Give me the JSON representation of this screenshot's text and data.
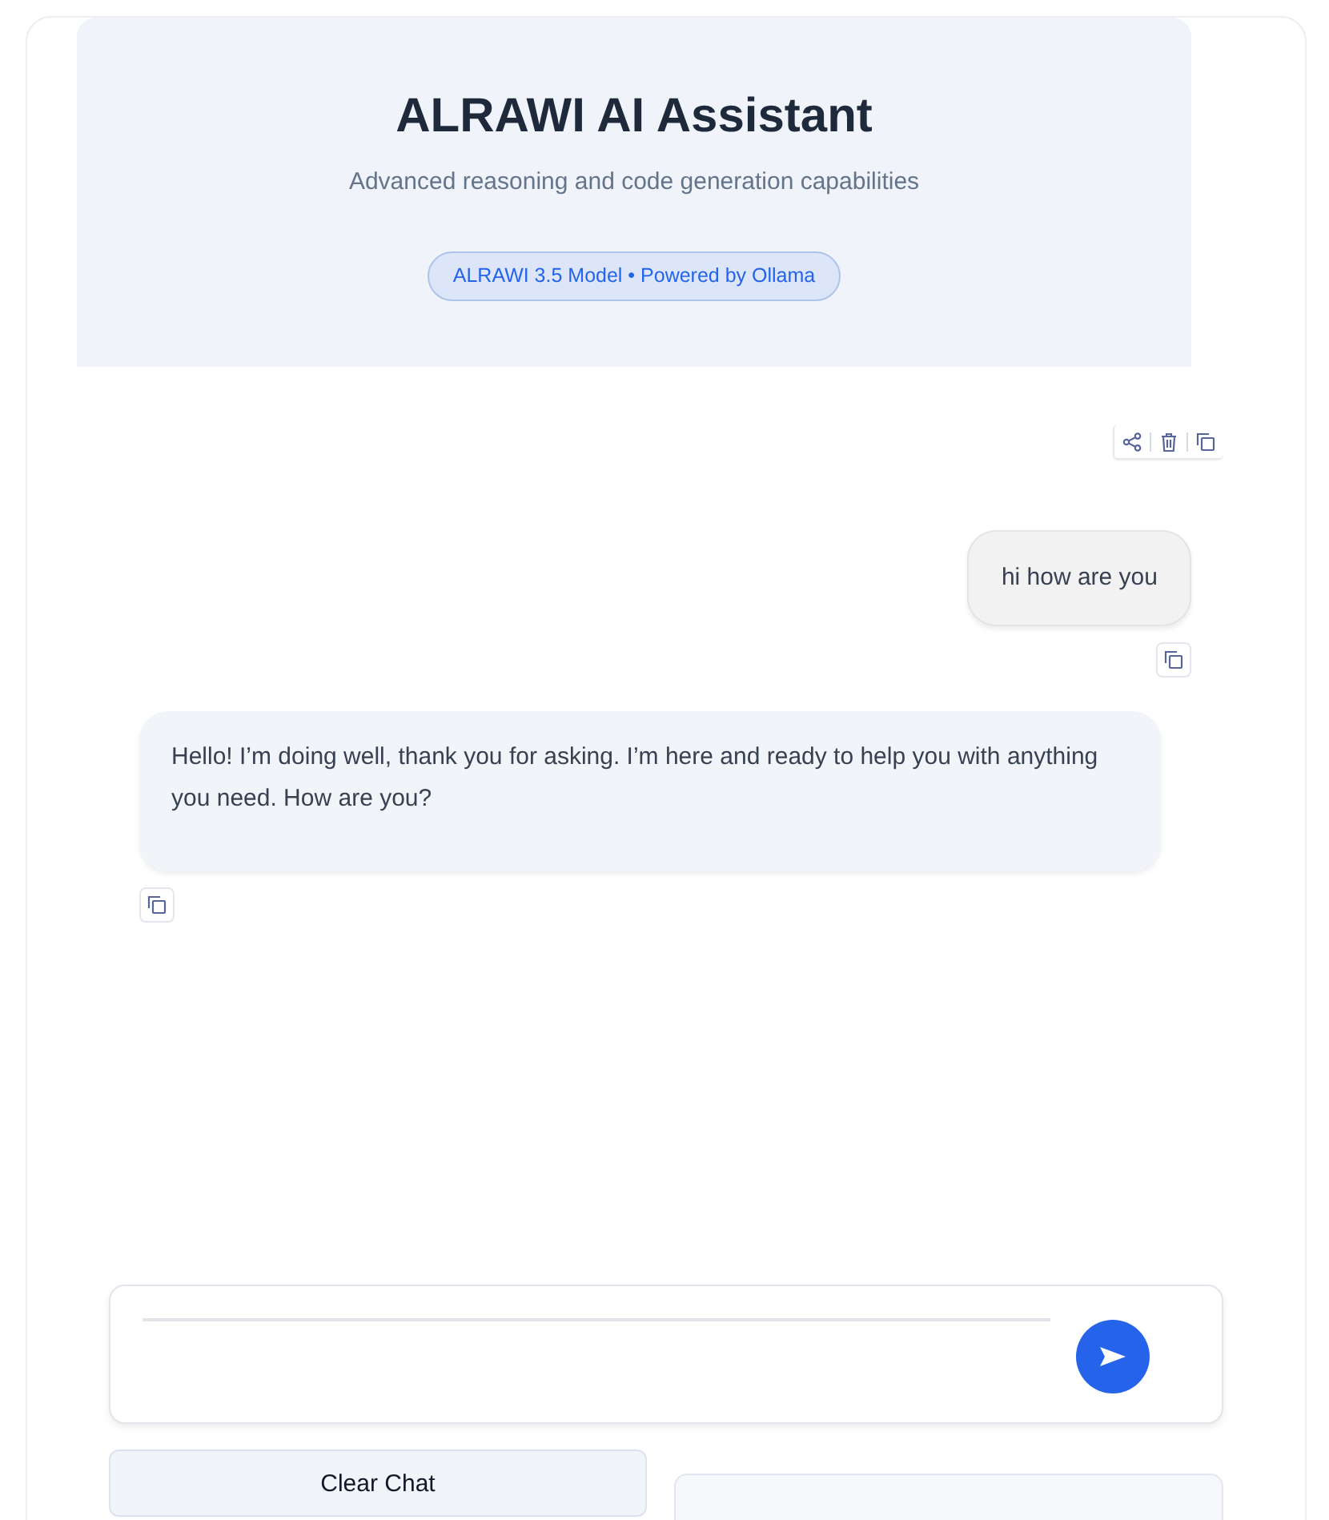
{
  "header": {
    "title": "ALRAWI AI Assistant",
    "subtitle": "Advanced reasoning and code generation capabilities",
    "badge": "ALRAWI 3.5 Model • Powered by Ollama"
  },
  "chat": {
    "toolbar": [
      {
        "kind": "share"
      },
      {
        "kind": "delete"
      },
      {
        "kind": "copy"
      }
    ],
    "messages": [
      {
        "kind": "user",
        "text": "hi how are you"
      },
      {
        "kind": "assistant",
        "text": "Hello! I’m doing well, thank you for asking. I’m here and ready to help you with anything you need. How are you?"
      }
    ]
  },
  "actions": {
    "buttons": [
      {
        "label": "Clear Chat"
      }
    ]
  }
}
